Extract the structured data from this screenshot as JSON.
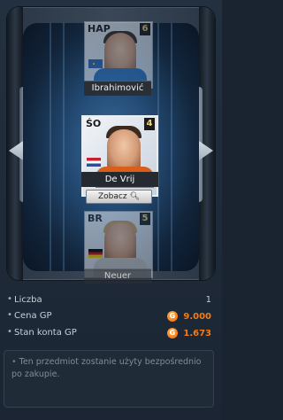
{
  "carousel": {
    "prev_card": {
      "position": "HAP",
      "number": "6",
      "name": "Ibrahimović"
    },
    "current_card": {
      "position": "ŚO",
      "number": "4",
      "name": "De Vrij",
      "view_button": "Zobacz"
    },
    "next_card": {
      "position": "BR",
      "number": "5",
      "name": "Neuer"
    }
  },
  "info": {
    "rows": [
      {
        "label": "Liczba",
        "value": "1"
      },
      {
        "label": "Cena GP",
        "value": "9.000"
      },
      {
        "label": "Stan konta GP",
        "value": "1.673"
      }
    ],
    "currency_icon": "G",
    "note": "Ten przedmiot zostanie użyty bezpośrednio po zakupie."
  },
  "colors": {
    "gp": "#f27b16",
    "background": "#1a2431",
    "accent": "#3c6da0"
  }
}
